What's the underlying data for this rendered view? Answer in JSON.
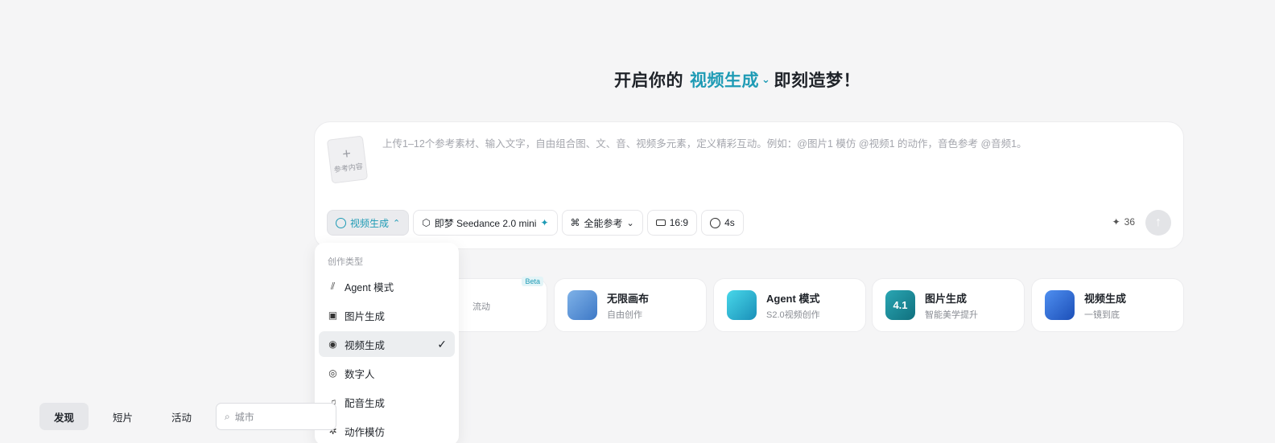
{
  "headline": {
    "prefix": "开启你的",
    "accent": "视频生成",
    "suffix": "即刻造梦！"
  },
  "composer": {
    "ref_label": "参考内容",
    "placeholder": "上传1–12个参考素材、输入文字，自由组合图、文、音、视频多元素，定义精彩互动。例如：@图片1 模仿 @视频1 的动作，音色参考 @音频1。",
    "toolbar": {
      "mode": "视频生成",
      "model": "即梦 Seedance 2.0 mini",
      "reference": "全能参考",
      "ratio": "16:9",
      "duration": "4s"
    },
    "credits": "36"
  },
  "cards": [
    {
      "title": "",
      "subtitle": "流动",
      "badge": "Beta"
    },
    {
      "title": "无限画布",
      "subtitle": "自由创作"
    },
    {
      "title": "Agent 模式",
      "subtitle": "S2.0视频创作"
    },
    {
      "title": "图片生成",
      "subtitle": "智能美学提升",
      "thumb_text": "4.1"
    },
    {
      "title": "视频生成",
      "subtitle": "一镜到底"
    }
  ],
  "dropdown": {
    "section": "创作类型",
    "items": [
      {
        "label": "Agent 模式",
        "icon": "agent-icon"
      },
      {
        "label": "图片生成",
        "icon": "image-icon"
      },
      {
        "label": "视频生成",
        "icon": "video-icon",
        "selected": true
      },
      {
        "label": "数字人",
        "icon": "digital-human-icon"
      },
      {
        "label": "配音生成",
        "icon": "music-icon"
      },
      {
        "label": "动作模仿",
        "icon": "motion-icon"
      }
    ]
  },
  "bottom_nav": {
    "tabs": [
      "发现",
      "短片",
      "活动"
    ],
    "search_placeholder": "城市"
  },
  "colors": {
    "accent": "#1f9bb5",
    "background": "#f5f5f6"
  }
}
